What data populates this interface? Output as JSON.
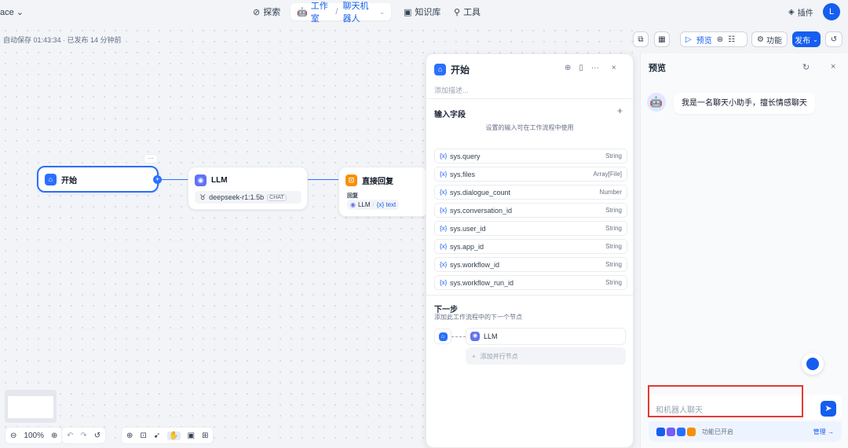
{
  "topbar": {
    "workspace": "ace ⌄",
    "nav": {
      "explore": "探索",
      "studio": "工作室",
      "app_name": "聊天机器人",
      "knowledge": "知识库",
      "tools": "工具"
    },
    "plugin": "插件",
    "avatar": "L"
  },
  "toolbar": {
    "autosave": "自动保存 01:43:34 · 已发布 14 分钟前",
    "preview": "预览",
    "features": "功能",
    "publish": "发布"
  },
  "nodes": {
    "start": {
      "title": "开始"
    },
    "llm": {
      "title": "LLM",
      "model": "deepseek-r1:1.5b",
      "mode": "CHAT"
    },
    "answer": {
      "title": "直接回复",
      "label": "回复",
      "ref_node": "LLM",
      "ref_var": "{x} text"
    },
    "more": "···"
  },
  "panel": {
    "title": "开始",
    "desc_placeholder": "添加描述...",
    "input_section": "输入字段",
    "input_hint": "设置的输入可在工作流程中使用",
    "vars": [
      {
        "name": "sys.query",
        "type": "String"
      },
      {
        "name": "sys.files",
        "type": "Array[File]"
      },
      {
        "name": "sys.dialogue_count",
        "type": "Number"
      },
      {
        "name": "sys.conversation_id",
        "type": "String"
      },
      {
        "name": "sys.user_id",
        "type": "String"
      },
      {
        "name": "sys.app_id",
        "type": "String"
      },
      {
        "name": "sys.workflow_id",
        "type": "String"
      },
      {
        "name": "sys.workflow_run_id",
        "type": "String"
      }
    ],
    "var_prefix": "{x}",
    "next_title": "下一步",
    "next_hint": "添加此工作流程中的下一个节点",
    "next_node": "LLM",
    "add_parallel": "添加并行节点"
  },
  "preview": {
    "title": "预览",
    "bot_message": "我是一名聊天小助手，擅长情感聊天",
    "input_placeholder": "和机器人聊天",
    "features_on": "功能已开启",
    "manage": "管理 →"
  },
  "zoom": {
    "level": "100%"
  },
  "colors": {
    "accent": "#155eef",
    "highlight": "#e53935",
    "llm": "#6172f3",
    "answer": "#f79009"
  }
}
